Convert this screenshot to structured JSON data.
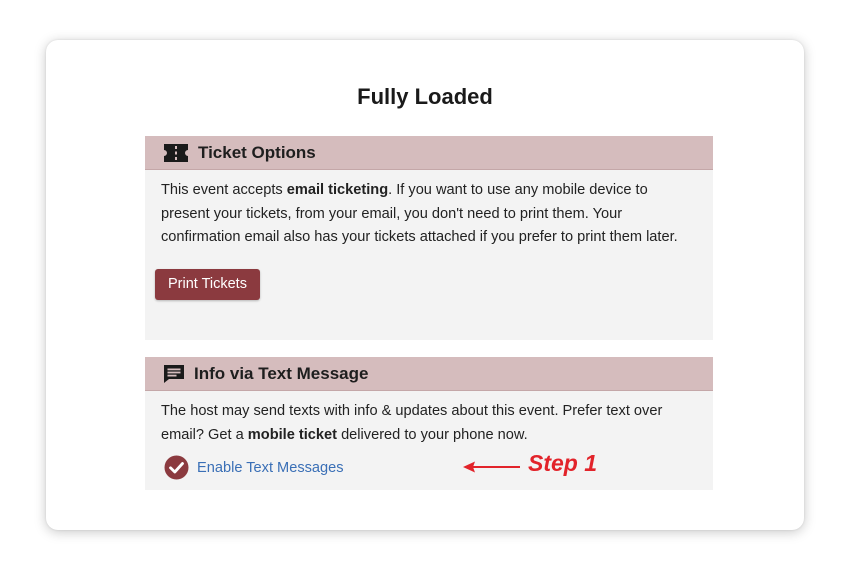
{
  "page": {
    "title": "Fully Loaded"
  },
  "ticket_section": {
    "icon": "ticket-icon",
    "title": "Ticket Options",
    "text_1": "This event accepts ",
    "text_bold": "email ticketing",
    "text_2": ". If you want to use any mobile device to present your tickets, from your email, you don't need to print them. Your confirmation email also has your tickets attached if you prefer to print them later.",
    "button_label": "Print Tickets"
  },
  "text_section": {
    "icon": "message-icon",
    "title": "Info via Text Message",
    "text_1": "The host may send texts with info & updates about this event. Prefer text over email? Get a ",
    "text_bold": "mobile ticket",
    "text_2": " delivered to your phone now.",
    "link_icon": "check-circle-icon",
    "link_label": "Enable Text Messages"
  },
  "annotation": {
    "label": "Step 1",
    "color": "#e2232a"
  },
  "colors": {
    "header_bg": "#d5bcbd",
    "section_bg": "#f3f3f3",
    "button_bg": "#8b3a3f",
    "link": "#3a6fb6"
  }
}
